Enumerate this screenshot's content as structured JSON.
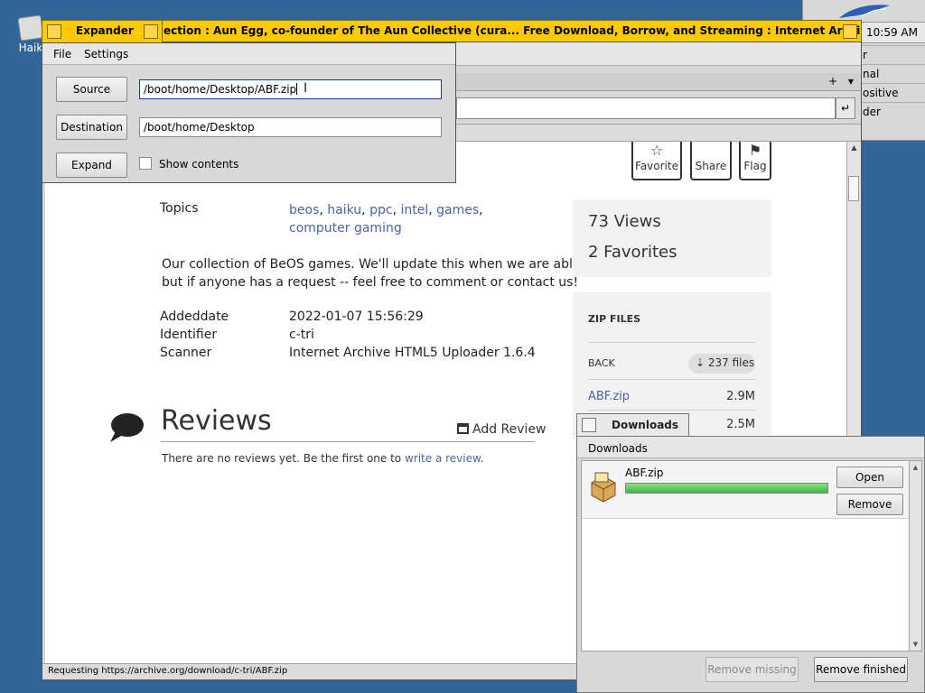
{
  "desktop": {
    "icon_label": "Haik"
  },
  "deskbar": {
    "clock": "10:59 AM",
    "items": [
      "r",
      "nal",
      "ositive",
      "der"
    ]
  },
  "browser": {
    "title": "ection : Aun Egg, co-founder of The Aun Collective (cura... Free Download, Borrow, and Streaming : Internet Archive - WebPositive",
    "status": "Requesting https://archive.org/download/c-tri/ABF.zip"
  },
  "page": {
    "actions": [
      {
        "icon": "☆",
        "label": "Favorite"
      },
      {
        "icon": "",
        "label": "Share"
      },
      {
        "icon": "⚑",
        "label": "Flag"
      }
    ],
    "topics_label": "Topics",
    "topics": [
      "beos",
      "haiku",
      "ppc",
      "intel",
      "games",
      "computer gaming"
    ],
    "description_line1": "Our collection of BeOS games. We'll update this when we are able to,",
    "description_line2": "but if anyone has a request -- feel free to comment or contact us!",
    "meta": [
      {
        "label": "Addeddate",
        "value": "2022-01-07 15:56:29"
      },
      {
        "label": "Identifier",
        "value": "c-tri"
      },
      {
        "label": "Scanner",
        "value": "Internet Archive HTML5 Uploader 1.6.4"
      }
    ],
    "views": "73 Views",
    "favorites": "2 Favorites",
    "zip_header": "ZIP FILES",
    "back_label": "BACK",
    "file_count": "237 files",
    "files": [
      {
        "name": "ABF.zip",
        "size": "2.9M"
      },
      {
        "name": "",
        "size": "2.5M"
      }
    ],
    "reviews_title": "Reviews",
    "add_review": "Add Review",
    "no_reviews_text": "There are no reviews yet. Be the first one to ",
    "write_review": "write a review",
    "period": "."
  },
  "expander": {
    "title": "Expander",
    "menu": {
      "file": "File",
      "settings": "Settings"
    },
    "source_button": "Source",
    "source_value": "/boot/home/Desktop/ABF.zip",
    "destination_button": "Destination",
    "destination_value": "/boot/home/Desktop",
    "expand_button": "Expand",
    "show_contents": "Show contents"
  },
  "downloads": {
    "title": "Downloads",
    "menu": "Downloads",
    "item_name": "ABF.zip",
    "progress": 1.0,
    "open_button": "Open",
    "remove_button": "Remove",
    "remove_missing": "Remove missing",
    "remove_finished": "Remove finished"
  },
  "colors": {
    "desktop": "#336698",
    "active_tab": "#ffcb00",
    "link": "#4b64a4",
    "progress": "#3cb83c"
  }
}
